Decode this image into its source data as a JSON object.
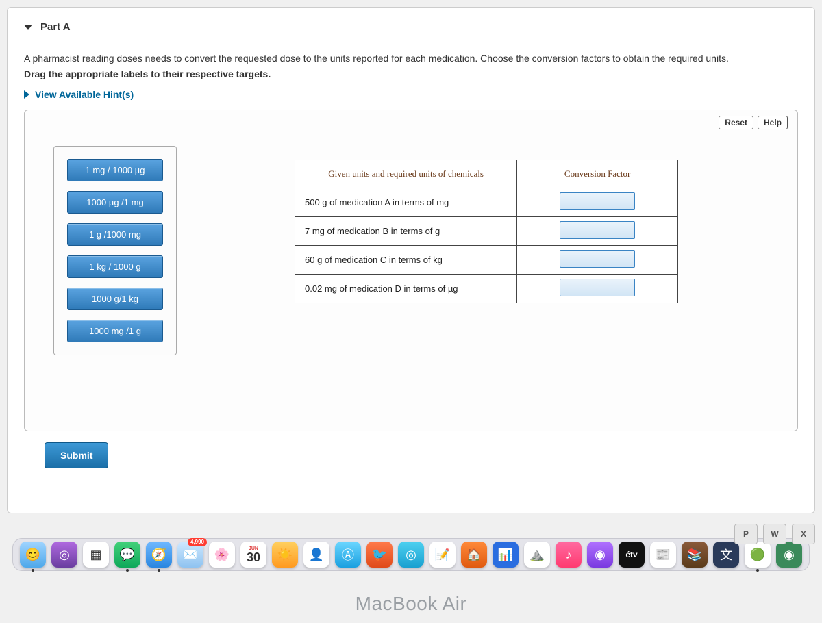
{
  "part": {
    "label": "Part A"
  },
  "instructions": {
    "line1": "A pharmacist reading doses needs to convert the requested dose to the units reported for each medication. Choose the conversion factors to obtain the required units.",
    "line2": "Drag the appropriate labels to their respective targets."
  },
  "hints": {
    "label": "View Available Hint(s)"
  },
  "buttons": {
    "reset": "Reset",
    "help": "Help",
    "submit": "Submit"
  },
  "labels": [
    "1 mg / 1000 µg",
    "1000 µg /1 mg",
    "1 g /1000 mg",
    "1 kg / 1000 g",
    "1000 g/1 kg",
    "1000 mg /1 g"
  ],
  "table": {
    "head_left": "Given units and required units of chemicals",
    "head_right": "Conversion Factor",
    "rows": [
      "500 g of medication A in terms of mg",
      "7 mg of medication B in terms of g",
      "60 g of medication C in terms of kg",
      "0.02 mg of medication D in terms of µg"
    ]
  },
  "dock": {
    "mail_badge": "4,990",
    "calendar_month": "JUN",
    "calendar_day": "30",
    "tv_label": "étv"
  },
  "brand": "MacBook Air",
  "keys": [
    "P",
    "W",
    "X"
  ]
}
